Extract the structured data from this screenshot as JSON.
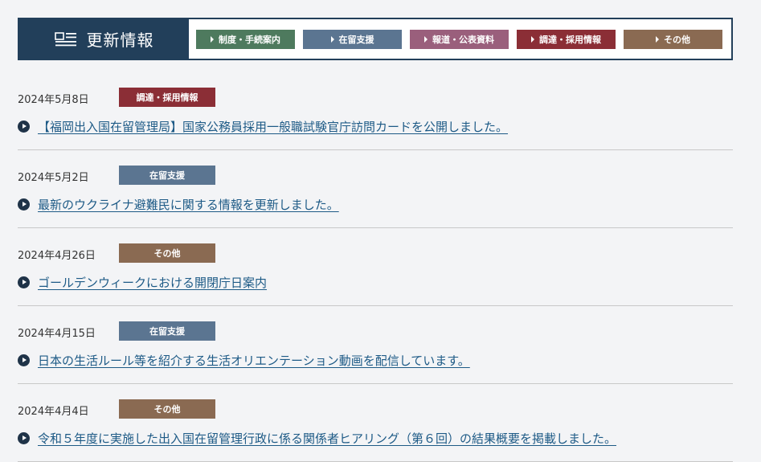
{
  "header": {
    "title": "更新情報",
    "icon": "news-list-icon",
    "categories": [
      {
        "label": "制度・手続案内",
        "color": "#4e7a5e"
      },
      {
        "label": "在留支援",
        "color": "#5b7591"
      },
      {
        "label": "報道・公表資料",
        "color": "#9a5f7c"
      },
      {
        "label": "調達・採用情報",
        "color": "#8b2e36"
      },
      {
        "label": "その他",
        "color": "#8a6a52"
      }
    ]
  },
  "colors": {
    "header_bg": "#223f5a",
    "link": "#1d5a86",
    "bullet": "#1f3348"
  },
  "items": [
    {
      "date": "2024年5月8日",
      "category": "調達・採用情報",
      "category_color": "#8b2e36",
      "title": "【福岡出入国在留管理局】国家公務員採用一般職試験官庁訪問カードを公開しました。"
    },
    {
      "date": "2024年5月2日",
      "category": "在留支援",
      "category_color": "#5b7591",
      "title": "最新のウクライナ避難民に関する情報を更新しました。"
    },
    {
      "date": "2024年4月26日",
      "category": "その他",
      "category_color": "#8a6a52",
      "title": "ゴールデンウィークにおける開閉庁日案内"
    },
    {
      "date": "2024年4月15日",
      "category": "在留支援",
      "category_color": "#5b7591",
      "title": "日本の生活ルール等を紹介する生活オリエンテーション動画を配信しています。"
    },
    {
      "date": "2024年4月4日",
      "category": "その他",
      "category_color": "#8a6a52",
      "title": "令和５年度に実施した出入国在留管理行政に係る関係者ヒアリング（第６回）の結果概要を掲載しました。"
    }
  ]
}
